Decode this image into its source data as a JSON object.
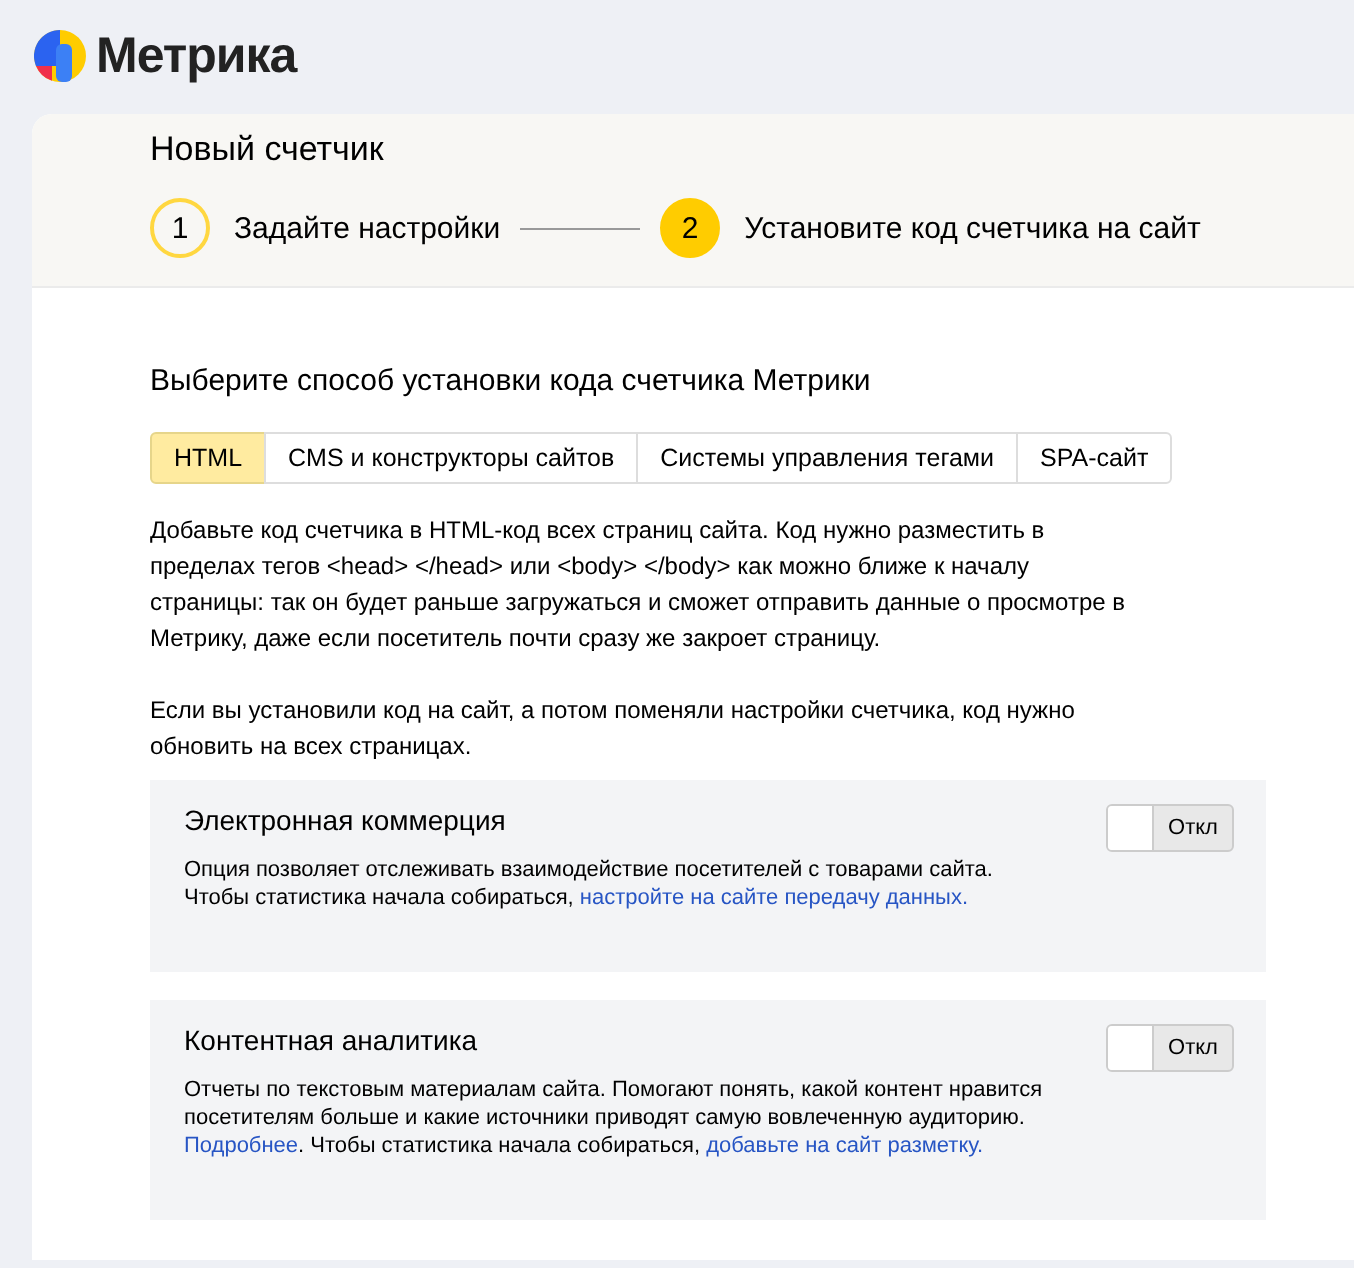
{
  "logo": {
    "text": "Метрика"
  },
  "page": {
    "title": "Новый счетчик"
  },
  "steps": [
    {
      "number": "1",
      "label": "Задайте настройки",
      "selected": false
    },
    {
      "number": "2",
      "label": "Установите код счетчика на сайт",
      "selected": true
    }
  ],
  "section_title": "Выберите способ установки кода счетчика Метрики",
  "tabs": [
    {
      "label": "HTML",
      "selected": true
    },
    {
      "label": "CMS и конструкторы сайтов",
      "selected": false
    },
    {
      "label": "Системы управления тегами",
      "selected": false
    },
    {
      "label": "SPA-сайт",
      "selected": false
    }
  ],
  "paragraphs": [
    [
      "Добавьте код счетчика в HTML-код всех страниц сайта. Код нужно разместить в",
      "пределах тегов <head> </head> или <body> </body> как можно ближе к началу",
      "страницы: так он будет раньше загружаться и сможет отправить данные о просмотре в",
      "Метрику, даже если посетитель почти сразу же закроет страницу."
    ],
    [
      "Если вы установили код на сайт, а потом поменяли настройки счетчика, код нужно",
      "обновить на всех страницах."
    ]
  ],
  "options": [
    {
      "title": "Электронная коммерция",
      "on": false,
      "toggle_label": "Откл",
      "lines": [
        [
          {
            "text": "Опция позволяет отслеживать взаимодействие посетителей с товарами сайта.",
            "link": false
          }
        ],
        [
          {
            "text": "Чтобы статистика начала собираться, ",
            "link": false
          },
          {
            "text": "настройте на сайте передачу данных.",
            "link": true
          }
        ]
      ]
    },
    {
      "title": "Контентная аналитика",
      "on": false,
      "toggle_label": "Откл",
      "lines": [
        [
          {
            "text": "Отчеты по текстовым материалам сайта. Помогают понять, какой контент нравится",
            "link": false
          }
        ],
        [
          {
            "text": "посетителям больше и какие источники приводят самую вовлеченную аудиторию.",
            "link": false
          }
        ],
        [
          {
            "text": "Подробнее",
            "link": true
          },
          {
            "text": ". Чтобы статистика начала собираться, ",
            "link": false
          },
          {
            "text": "добавьте на сайт разметку.",
            "link": true
          }
        ]
      ]
    }
  ]
}
